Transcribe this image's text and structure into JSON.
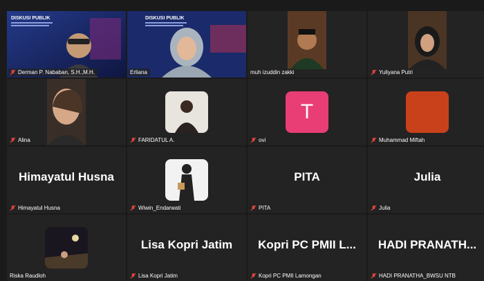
{
  "participants": [
    {
      "name": "Derman P. Nababan, S.H.,M.H.",
      "mic": "muted",
      "display": "video",
      "tile_color": "#1b2a66"
    },
    {
      "name": "Erliana",
      "mic": "active",
      "display": "video",
      "tile_color": "#1b2a66",
      "speaking": true
    },
    {
      "name": "muh izuddin zakki",
      "mic": "muted",
      "display": "video",
      "tile_color": "#2a2a2a"
    },
    {
      "name": "Yuliyana Putri",
      "mic": "muted",
      "display": "video",
      "tile_color": "#3a2a22"
    },
    {
      "name": "Alina",
      "mic": "muted",
      "display": "video",
      "tile_color": "#2a2420"
    },
    {
      "name": "FARIDATUL A.",
      "mic": "muted",
      "display": "photo",
      "tile_color": "#232323"
    },
    {
      "name": "ovi",
      "mic": "muted",
      "display": "letter",
      "letter": "T",
      "tile_color": "#232323",
      "avatar_color": "#e83e75"
    },
    {
      "name": "Muhammad Miftah",
      "mic": "muted",
      "display": "color",
      "tile_color": "#232323",
      "avatar_color": "#c8411a"
    },
    {
      "name": "Himayatul Husna",
      "mic": "muted",
      "display": "bigname",
      "big_label": "Himayatul Husna",
      "tile_color": "#232323"
    },
    {
      "name": "Wiwin_Endarwati",
      "mic": "muted",
      "display": "photo",
      "tile_color": "#232323"
    },
    {
      "name": "PITA",
      "mic": "muted",
      "display": "bigname",
      "big_label": "PITA",
      "tile_color": "#232323"
    },
    {
      "name": "Julia",
      "mic": "muted",
      "display": "bigname",
      "big_label": "Julia",
      "tile_color": "#232323"
    },
    {
      "name": "Riska Raudloh",
      "mic": "muted",
      "display": "photo",
      "tile_color": "#232323"
    },
    {
      "name": "Lisa Kopri Jatim",
      "mic": "muted",
      "display": "bigname",
      "big_label": "Lisa Kopri Jatim",
      "tile_color": "#232323"
    },
    {
      "name": "Kopri PC PMII Lamongan",
      "mic": "muted",
      "display": "bigname",
      "big_label": "Kopri PC PMII L...",
      "tile_color": "#232323"
    },
    {
      "name": "HADI PRANATHA_BWSU NTB",
      "mic": "muted",
      "display": "bigname",
      "big_label": "HADI PRANATH...",
      "tile_color": "#232323"
    }
  ],
  "banner": {
    "title": "DISKUSI PUBLIK"
  },
  "colors": {
    "speaking_border": "#2ee88a",
    "muted_icon": "#e0443e"
  }
}
